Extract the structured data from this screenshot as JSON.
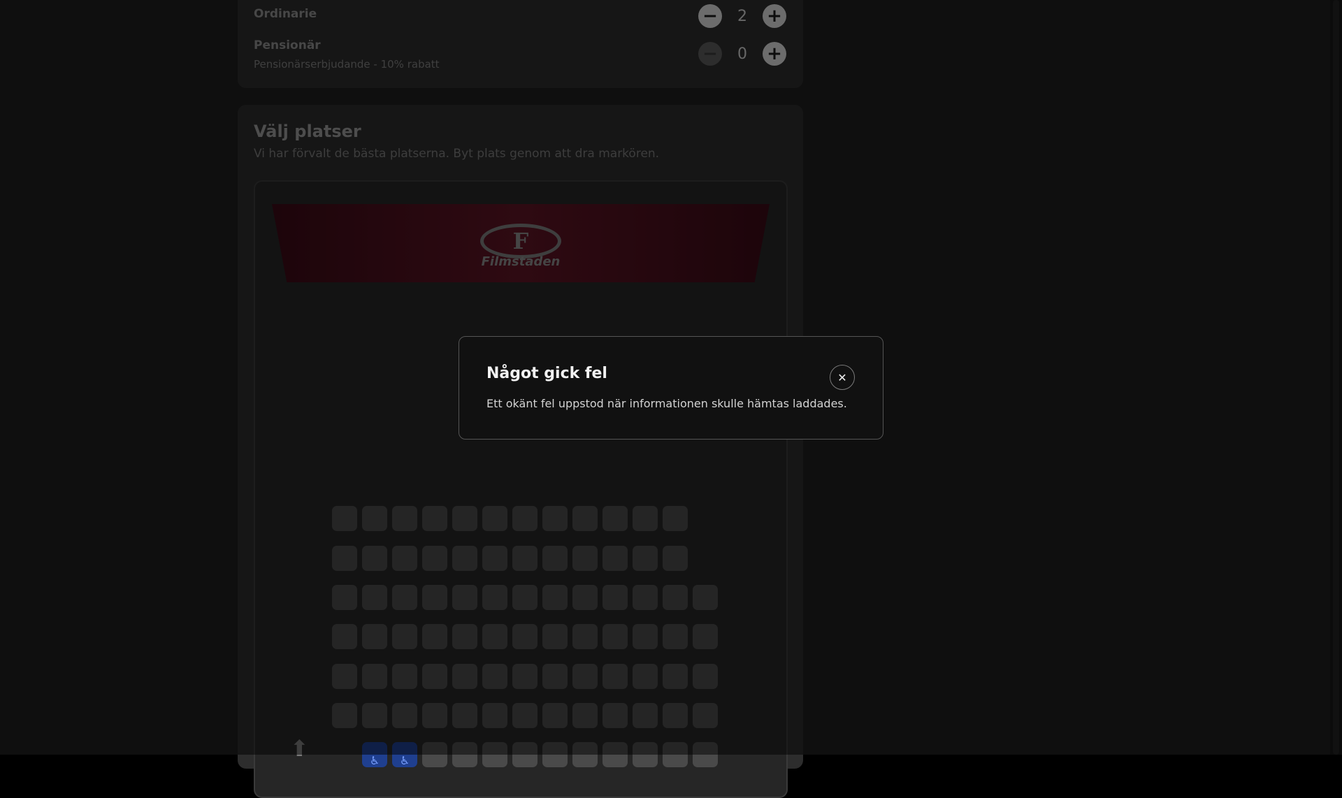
{
  "tickets": {
    "items": [
      {
        "name": "Ordinarie",
        "subtitle": "",
        "count": "2",
        "minus": "−",
        "plus": "+"
      },
      {
        "name": "Pensionär",
        "subtitle": "Pensionärserbjudande - 10% rabatt",
        "count": "0",
        "minus": "−",
        "plus": "+"
      }
    ]
  },
  "seats": {
    "title": "Välj platser",
    "subtitle": "Vi har förvalt de bästa platserna. Byt plats genom att dra markören.",
    "screen_logo": {
      "letter": "F",
      "text": "Filmstaden"
    },
    "rows": [
      12,
      12,
      13,
      13,
      13,
      13,
      13
    ],
    "wheelchair_seats_last_row": 2,
    "exit_icon": "up-arrow-icon"
  },
  "modal": {
    "title": "Något gick fel",
    "message": "Ett okänt fel uppstod när informationen skulle hämtas laddades.",
    "close_icon": "close-icon"
  },
  "colors": {
    "background": "#1f1f1f",
    "card": "#2d2d2d",
    "screen": "#5d1424",
    "modal": "#111111",
    "wheelchair": "#1f3f8f"
  }
}
